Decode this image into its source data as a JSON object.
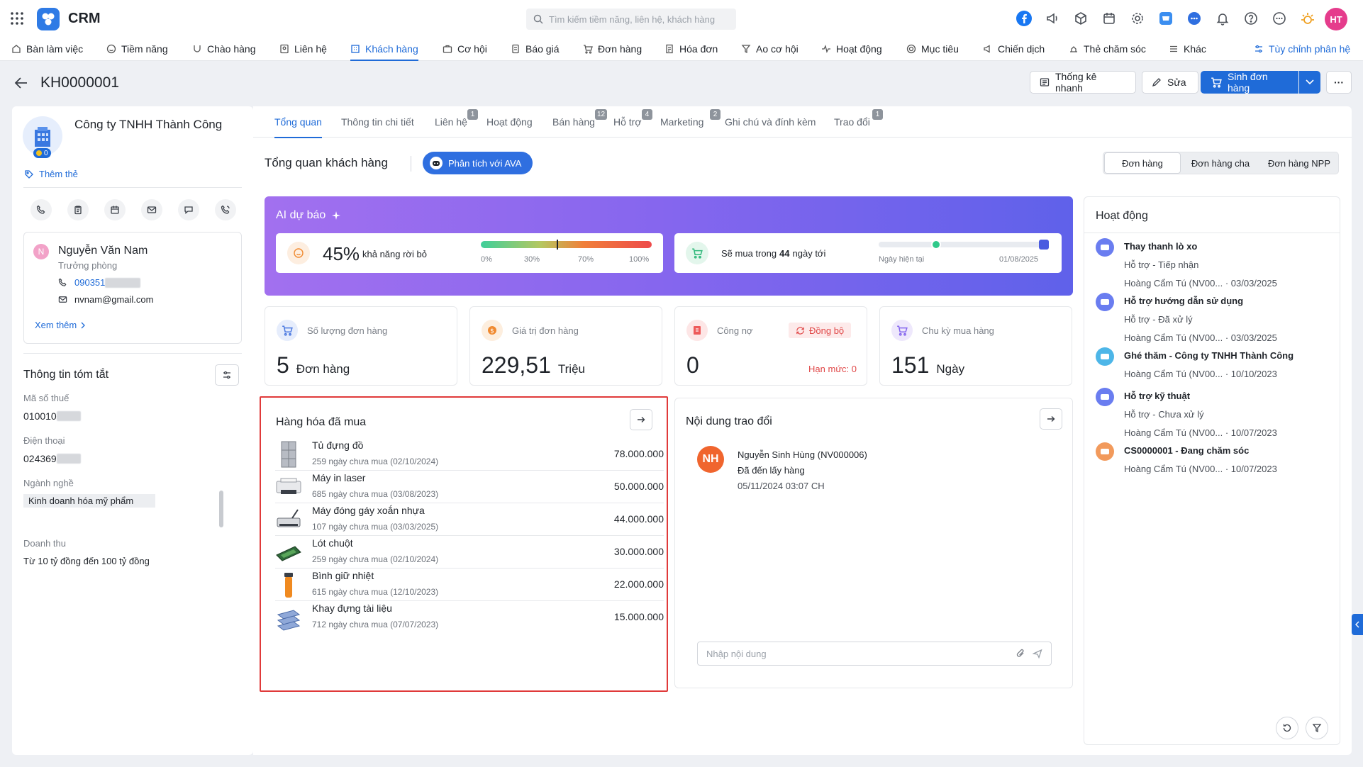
{
  "app": {
    "name": "CRM",
    "avatar": "HT"
  },
  "search": {
    "placeholder": "Tìm kiếm tiềm năng, liên hệ, khách hàng"
  },
  "nav": {
    "items": [
      "Bàn làm việc",
      "Tiềm năng",
      "Chào hàng",
      "Liên hệ",
      "Khách hàng",
      "Cơ hội",
      "Báo giá",
      "Đơn hàng",
      "Hóa đơn",
      "Ao cơ hội",
      "Hoạt động",
      "Mục tiêu",
      "Chiến dịch",
      "Thẻ chăm sóc",
      "Khác"
    ],
    "active": "Khách hàng",
    "customize": "Tùy chỉnh phân hệ"
  },
  "header": {
    "code": "KH0000001",
    "quick_stats": "Thống kê nhanh",
    "edit": "Sửa",
    "create_order": "Sinh đơn hàng",
    "more": "···"
  },
  "profile": {
    "company": "Công ty TNHH Thành Công",
    "add_tag": "Thêm thẻ",
    "badge_count": "0",
    "contact": {
      "initial": "N",
      "name": "Nguyễn Văn Nam",
      "title": "Trưởng phòng",
      "phone": "090351",
      "email": "nvnam@gmail.com",
      "see_more": "Xem thêm"
    }
  },
  "summary": {
    "title": "Thông tin tóm tắt",
    "tax_label": "Mã số thuế",
    "tax_value": "010010",
    "phone_label": "Điện thoại",
    "phone_value": "024369",
    "industry_label": "Ngành nghề",
    "industry_value": "Kinh doanh hóa mỹ phẩm",
    "revenue_label": "Doanh thu",
    "revenue_value": "Từ 10 tỷ đồng đến 100 tỷ đồng"
  },
  "tabs": [
    {
      "label": "Tổng quan",
      "badge": ""
    },
    {
      "label": "Thông tin chi tiết",
      "badge": ""
    },
    {
      "label": "Liên hệ",
      "badge": "1"
    },
    {
      "label": "Hoạt động",
      "badge": ""
    },
    {
      "label": "Bán hàng",
      "badge": "12"
    },
    {
      "label": "Hỗ trợ",
      "badge": "4"
    },
    {
      "label": "Marketing",
      "badge": "2"
    },
    {
      "label": "Ghi chú và đính kèm",
      "badge": ""
    },
    {
      "label": "Trao đổi",
      "badge": "1"
    }
  ],
  "overview": {
    "title": "Tổng quan khách hàng",
    "ava_button": "Phân tích với AVA",
    "segments": [
      "Đơn hàng",
      "Đơn hàng cha",
      "Đơn hàng NPP"
    ]
  },
  "ai": {
    "title": "AI dự báo",
    "churn_value": "45%",
    "churn_text": "khả năng rời bỏ",
    "churn_level": 0.45,
    "scale": [
      "0%",
      "30%",
      "70%",
      "100%"
    ],
    "buy_text_pre": "Sẽ mua trong",
    "buy_days": "44",
    "buy_text_post": "ngày tới",
    "today_label": "Ngày hiện tại",
    "target_date": "01/08/2025"
  },
  "stats": [
    {
      "label": "Số lượng đơn hàng",
      "value": "5",
      "unit": "Đơn hàng"
    },
    {
      "label": "Giá trị đơn hàng",
      "value": "229,51",
      "unit": "Triệu"
    },
    {
      "label": "Công nợ",
      "value": "0",
      "unit": "",
      "sync": "Đồng bộ",
      "limit": "Hạn mức: 0"
    },
    {
      "label": "Chu kỳ mua hàng",
      "value": "151",
      "unit": "Ngày"
    }
  ],
  "purchased": {
    "title": "Hàng hóa đã mua",
    "items": [
      {
        "name": "Tủ đựng đồ",
        "days": "259 ngày chưa mua (02/10/2024)",
        "value": "78.000.000"
      },
      {
        "name": "Máy in laser",
        "days": "685 ngày chưa mua (03/08/2023)",
        "value": "50.000.000"
      },
      {
        "name": "Máy đóng gáy xoắn nhựa",
        "days": "107 ngày chưa mua (03/03/2025)",
        "value": "44.000.000"
      },
      {
        "name": "Lót chuột",
        "days": "259 ngày chưa mua (02/10/2024)",
        "value": "30.000.000"
      },
      {
        "name": "Bình giữ nhiệt",
        "days": "615 ngày chưa mua (12/10/2023)",
        "value": "22.000.000"
      },
      {
        "name": "Khay đựng tài liệu",
        "days": "712 ngày chưa mua (07/07/2023)",
        "value": "15.000.000"
      }
    ]
  },
  "exchange": {
    "title": "Nội dung trao đổi",
    "initials": "NH",
    "author": "Nguyễn Sinh Hùng (NV000006)",
    "message": "Đã đến lấy hàng",
    "time": "05/11/2024 03:07 CH",
    "input_placeholder": "Nhập nội dung"
  },
  "activity": {
    "title": "Hoạt động",
    "items": [
      {
        "title": "Thay thanh lò xo",
        "sub": "Hỗ trợ - Tiếp nhận",
        "by": "Hoàng Cẩm Tú (NV00...",
        "date": "03/03/2025",
        "color": "#6a7df0"
      },
      {
        "title": "Hỗ trợ hướng dẫn sử dụng",
        "sub": "Hỗ trợ - Đã xử lý",
        "by": "Hoàng Cẩm Tú (NV00...",
        "date": "03/03/2025",
        "color": "#6a7df0"
      },
      {
        "title": "Ghé thăm - Công ty TNHH Thành Công",
        "sub": "",
        "by": "Hoàng Cẩm Tú (NV00...",
        "date": "10/10/2023",
        "color": "#4db6e8"
      },
      {
        "title": "Hỗ trợ kỹ thuật",
        "sub": "Hỗ trợ - Chưa xử lý",
        "by": "Hoàng Cẩm Tú (NV00...",
        "date": "10/07/2023",
        "color": "#6a7df0"
      },
      {
        "title": "CS0000001 - Đang chăm sóc",
        "sub": "",
        "by": "Hoàng Cẩm Tú (NV00...",
        "date": "10/07/2023",
        "color": "#f29a5c"
      }
    ]
  }
}
